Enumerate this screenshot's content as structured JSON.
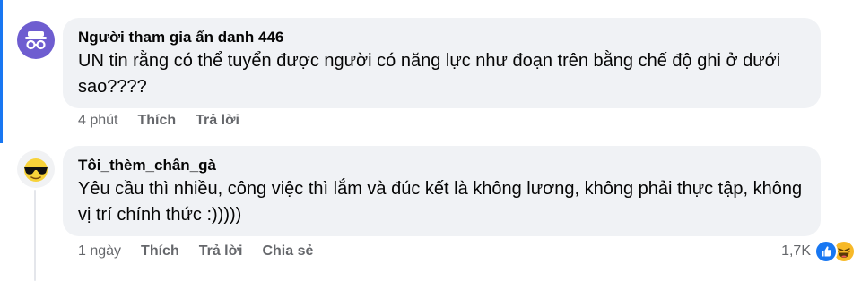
{
  "comments": [
    {
      "author": "Người tham gia ẩn danh 446",
      "text": "UN tin rằng có thể tuyển được người có năng lực như đoạn trên bằng chế độ ghi ở dưới sao????",
      "time": "4 phút",
      "like_label": "Thích",
      "reply_label": "Trả lời",
      "avatar_icon": "anonymous-incognito-icon"
    },
    {
      "author": "Tôi_thèm_chân_gà",
      "text": "Yêu cầu thì nhiều, công việc thì lắm và đúc kết là không lương, không phải thực tập, không vị trí chính thức :)))))",
      "time": "1 ngày",
      "like_label": "Thích",
      "reply_label": "Trả lời",
      "share_label": "Chia sẻ",
      "reaction_count": "1,7K",
      "reaction_icons": [
        "like-reaction-icon",
        "haha-reaction-icon"
      ],
      "avatar_icon": "sunglasses-emoji-avatar-icon"
    }
  ],
  "colors": {
    "accent": "#1877f2",
    "bubble": "#f0f2f5",
    "muted_text": "#65676b",
    "anon_avatar": "#6e5dd0"
  }
}
